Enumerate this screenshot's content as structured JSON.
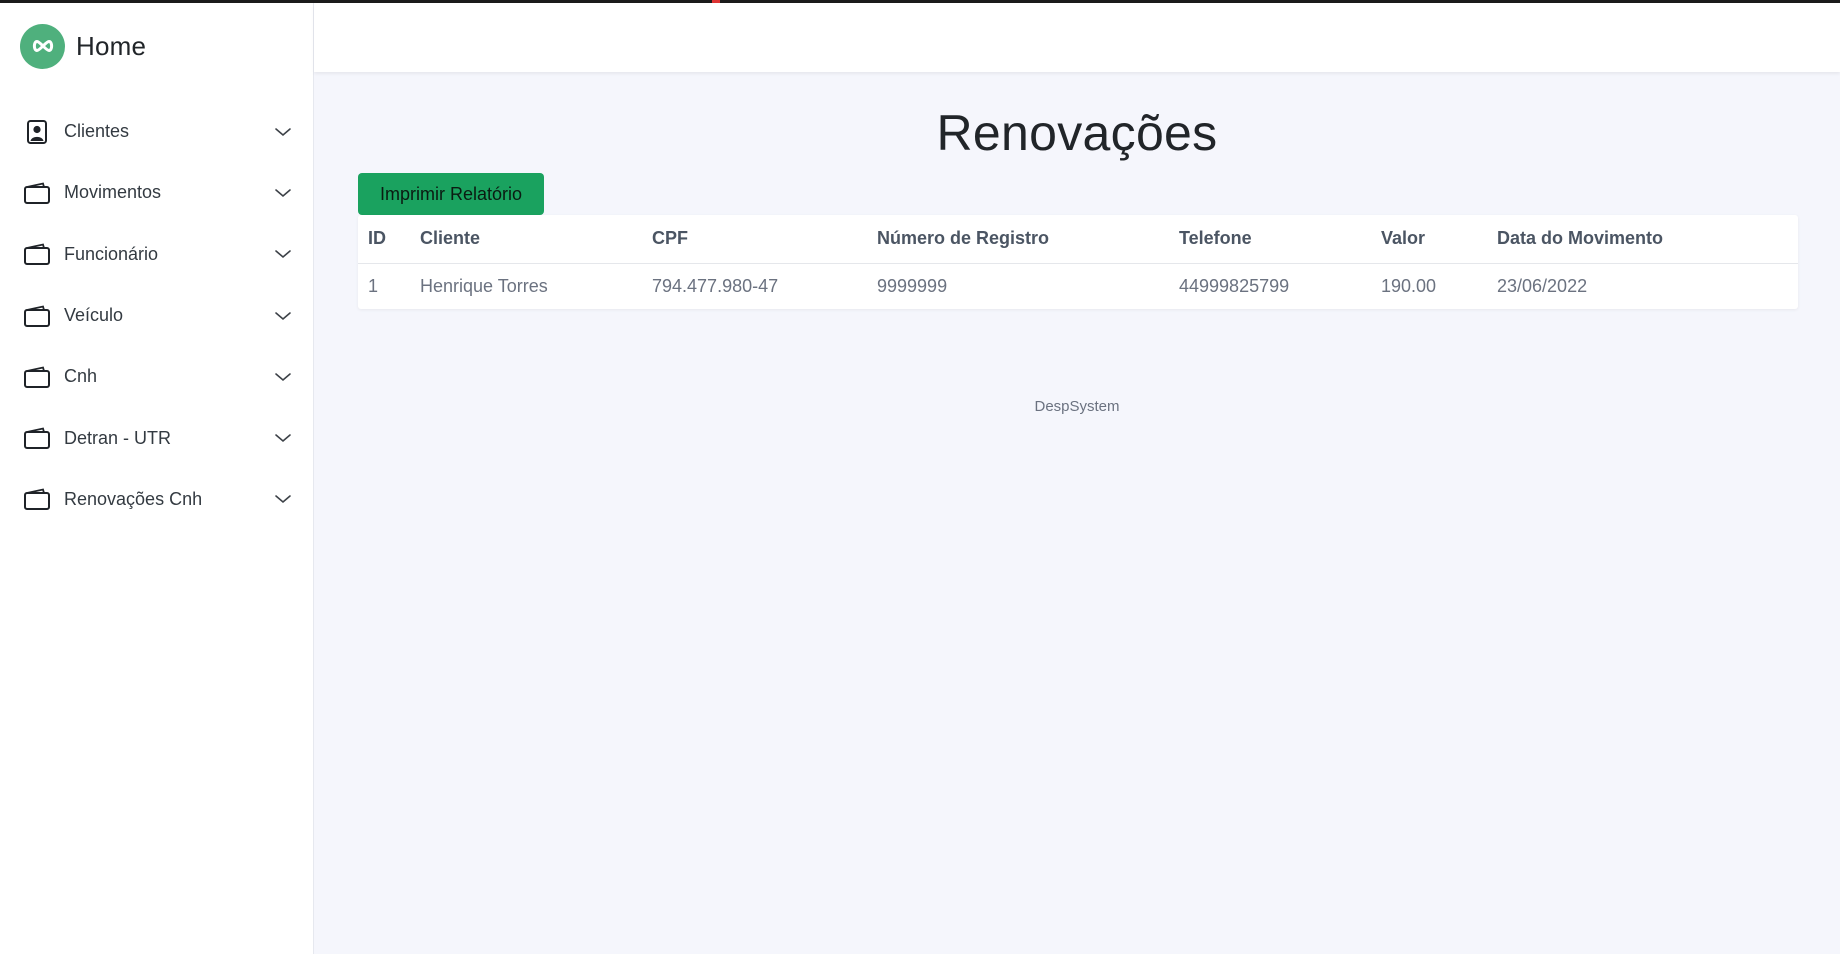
{
  "app": {
    "brand_title": "Home",
    "accent_color": "#1aa25f",
    "logo_color": "#4fb07d"
  },
  "sidebar": {
    "items": [
      {
        "label": "Clientes",
        "icon": "person-badge-icon"
      },
      {
        "label": "Movimentos",
        "icon": "wallet-icon"
      },
      {
        "label": "Funcionário",
        "icon": "wallet-icon"
      },
      {
        "label": "Veículo",
        "icon": "wallet-icon"
      },
      {
        "label": "Cnh",
        "icon": "wallet-icon"
      },
      {
        "label": "Detran - UTR",
        "icon": "wallet-icon"
      },
      {
        "label": "Renovações Cnh",
        "icon": "wallet-icon"
      }
    ]
  },
  "main": {
    "title": "Renovações",
    "print_button": "Imprimir Relatório",
    "table": {
      "headers": [
        "ID",
        "Cliente",
        "CPF",
        "Número de Registro",
        "Telefone",
        "Valor",
        "Data do Movimento"
      ],
      "rows": [
        [
          "1",
          "Henrique Torres",
          "794.477.980-47",
          "9999999",
          "44999825799",
          "190.00",
          "23/06/2022"
        ]
      ]
    },
    "footer": "DespSystem"
  }
}
